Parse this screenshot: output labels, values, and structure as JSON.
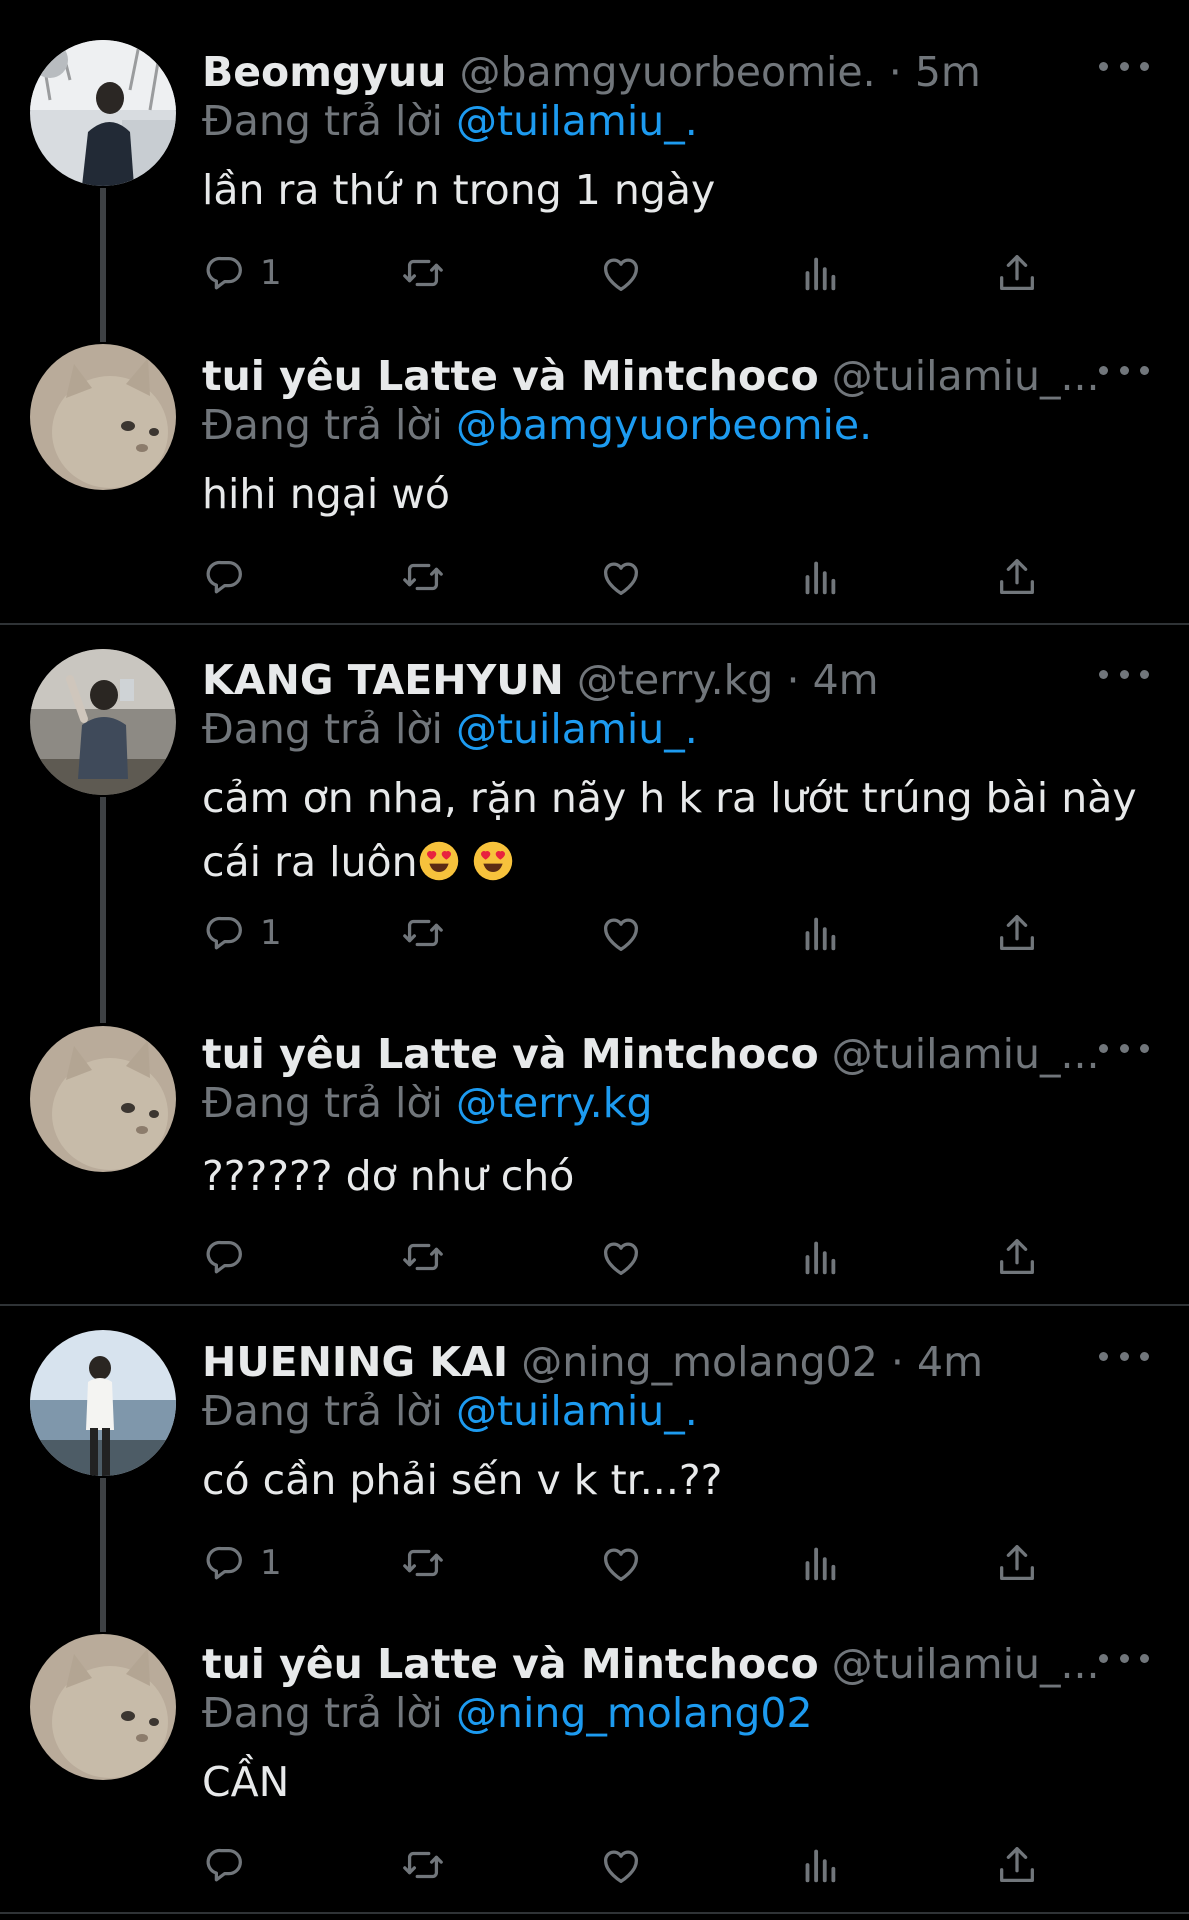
{
  "replying_label": "Đang trả lời",
  "tweets": [
    {
      "name": "Beomgyuu",
      "handle": "@bamgyuorbeomie.",
      "dot": "·",
      "time": "5m",
      "mention": "@tuilamiu_.",
      "text": "lần ra thứ n trong 1 ngày",
      "reply_count": "1"
    },
    {
      "name": "tui yêu Latte và Mintchoco",
      "handle": "@tuilamiu_....",
      "mention": "@bamgyuorbeomie.",
      "text": "hihi ngại wó",
      "reply_count": ""
    },
    {
      "name": "KANG TAEHYUN",
      "handle": "@terry.kg",
      "dot": "·",
      "time": "4m",
      "mention": "@tuilamiu_.",
      "text": "cảm ơn nha, rặn nãy h k ra lướt trúng bài này cái ra luôn",
      "reply_count": "1"
    },
    {
      "name": "tui yêu Latte và Mintchoco",
      "handle": "@tuilamiu_....",
      "mention": "@terry.kg",
      "text": "?????? dơ như chó",
      "reply_count": ""
    },
    {
      "name": "HUENING KAI",
      "handle": "@ning_molang02",
      "dot": "·",
      "time": "4m",
      "mention": "@tuilamiu_.",
      "text": "có cần phải sến v k tr...??",
      "reply_count": "1"
    },
    {
      "name": "tui yêu Latte và Mintchoco",
      "handle": "@tuilamiu_....",
      "mention": "@ning_molang02",
      "text": "CẦN",
      "reply_count": ""
    }
  ],
  "colors": {
    "background": "#000000",
    "name": "#e7e9ea",
    "secondary": "#71767b",
    "mention": "#1d9bf0",
    "divider": "#2f3336",
    "thread_line": "#3e4144"
  },
  "icons": [
    "reply-icon",
    "retweet-icon",
    "like-icon",
    "analytics-icon",
    "share-icon",
    "more-icon",
    "heart-eyes-emoji"
  ]
}
